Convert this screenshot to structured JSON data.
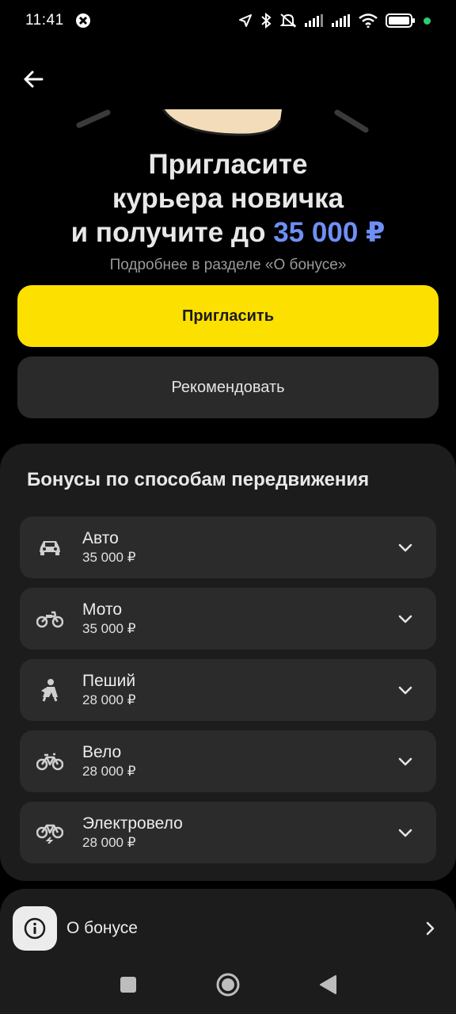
{
  "status_bar": {
    "time": "11:41",
    "accent_green": "#2ecc71"
  },
  "hero": {
    "title_line1": "Пригласите",
    "title_line2": "курьера новичка",
    "title_line3_prefix": "и получите до ",
    "title_amount": "35 000 ₽",
    "subtitle": "Подробнее в разделе «О бонусе»",
    "invite_label": "Пригласить",
    "recommend_label": "Рекомендовать",
    "accent_yellow": "#fce000",
    "accent_blue": "#6f8ff5"
  },
  "bonuses": {
    "heading": "Бонусы по способам передвижения",
    "items": [
      {
        "name": "Авто",
        "value": "35 000 ₽",
        "icon": "car-icon"
      },
      {
        "name": "Мото",
        "value": "35 000 ₽",
        "icon": "motorcycle-icon"
      },
      {
        "name": "Пеший",
        "value": "28 000 ₽",
        "icon": "pedestrian-icon"
      },
      {
        "name": "Вело",
        "value": "28 000 ₽",
        "icon": "bicycle-icon"
      },
      {
        "name": "Электровело",
        "value": "28 000 ₽",
        "icon": "electric-bicycle-icon"
      }
    ]
  },
  "about": {
    "label": "О бонусе",
    "icon": "info-icon"
  },
  "navigation": {
    "recents_icon": "square-icon",
    "home_icon": "circle-icon",
    "back_icon": "triangle-back-icon"
  }
}
